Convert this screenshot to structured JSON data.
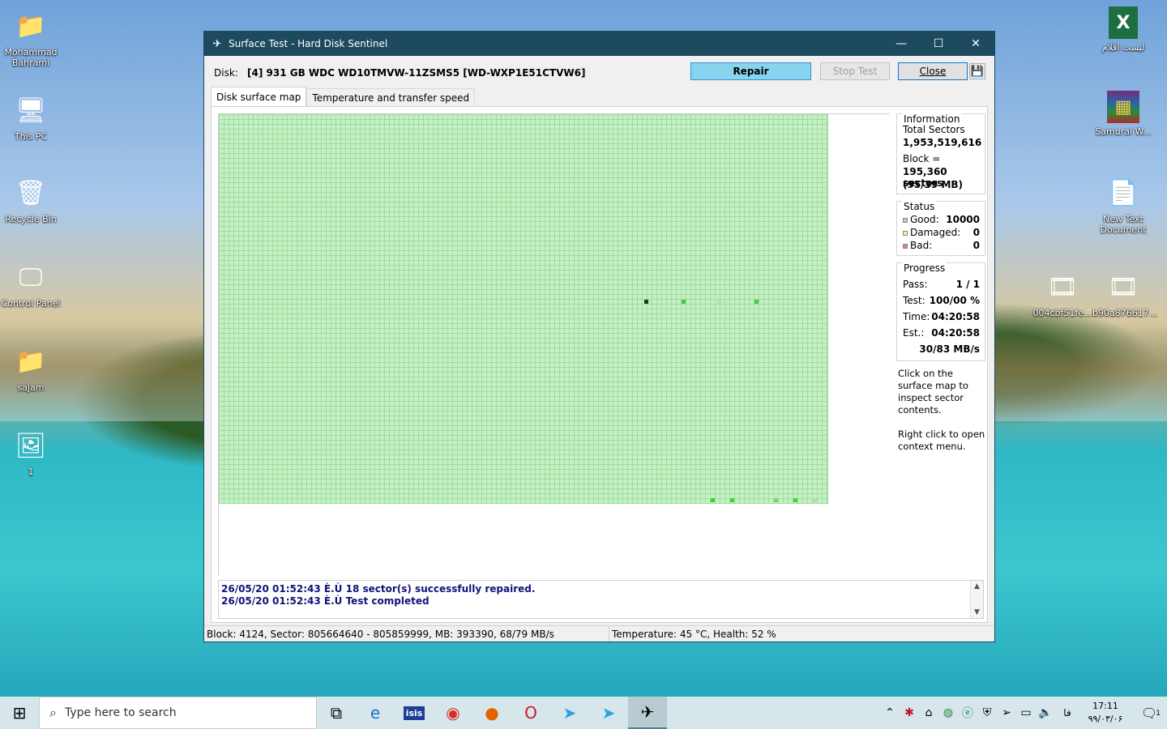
{
  "desktop": {
    "left_icons": [
      {
        "name": "Mohammad Bahrami",
        "glyph": "📁"
      },
      {
        "name": "This PC",
        "glyph": "🖥"
      },
      {
        "name": "Recycle Bin",
        "glyph": "🗑"
      },
      {
        "name": "Control Panel",
        "glyph": "🖵"
      },
      {
        "name": "sajam",
        "glyph": "📁"
      },
      {
        "name": "1",
        "glyph": "🖼"
      }
    ],
    "right_icons": [
      {
        "name": "ليست اقلام",
        "glyph": "X"
      },
      {
        "name": "Samurai W...",
        "glyph": "▦"
      },
      {
        "name": "New Text Document",
        "glyph": "📄"
      },
      {
        "name": "004cbf51fe...",
        "glyph": "🎞"
      },
      {
        "name": "b90a876617...",
        "glyph": "🎞"
      }
    ]
  },
  "window": {
    "title": "Surface Test - Hard Disk Sentinel",
    "disk_label": "Disk:",
    "disk_name": "[4] 931 GB  WDC WD10TMVW-11ZSMS5 [WD-WXP1E51CTVW6]",
    "buttons": {
      "repair": "Repair",
      "stop": "Stop Test",
      "close": "Close"
    },
    "tabs": [
      "Disk surface map",
      "Temperature and transfer speed"
    ],
    "information": {
      "caption": "Information",
      "total_sectors_label": "Total Sectors",
      "total_sectors": "1,953,519,616",
      "block_label": "Block =",
      "block_sectors": "195,360 sectors",
      "block_mb": "(95/39 MB)"
    },
    "status": {
      "caption": "Status",
      "good_label": "Good:",
      "good": "10000",
      "damaged_label": "Damaged:",
      "damaged": "0",
      "bad_label": "Bad:",
      "bad": "0",
      "colors": {
        "good": "#9fe09f",
        "damaged": "#f3f38a",
        "bad": "#e08080"
      }
    },
    "progress": {
      "caption": "Progress",
      "pass_label": "Pass:",
      "pass": "1 / 1",
      "test_label": "Test:",
      "test": "100/00 %",
      "time_label": "Time:",
      "time": "04:20:58",
      "est_label": "Est.:",
      "est": "04:20:58",
      "speed": "30/83 MB/s"
    },
    "hint1": "Click on the surface map to inspect sector contents.",
    "hint2": "Right click to open context menu.",
    "log": [
      "26/05/20  01:52:43 È.Ù   18 sector(s) successfully repaired.",
      "26/05/20  01:52:43 È.Ù   Test completed"
    ],
    "statusbar": {
      "left": "Block: 4124, Sector: 805664640 - 805859999, MB: 393390, 68/79 MB/s",
      "right": "Temperature: 45  °C,  Health: 52 %"
    }
  },
  "taskbar": {
    "search_placeholder": "Type here to search",
    "apps": [
      "task-view",
      "edge",
      "isis",
      "chrome",
      "firefox",
      "opera",
      "telegram",
      "telegram-2",
      "hard-disk-sentinel"
    ],
    "lang": "فا",
    "time": "17:11",
    "date": "۹۹/۰۳/۰۶",
    "notification_count": "1"
  }
}
